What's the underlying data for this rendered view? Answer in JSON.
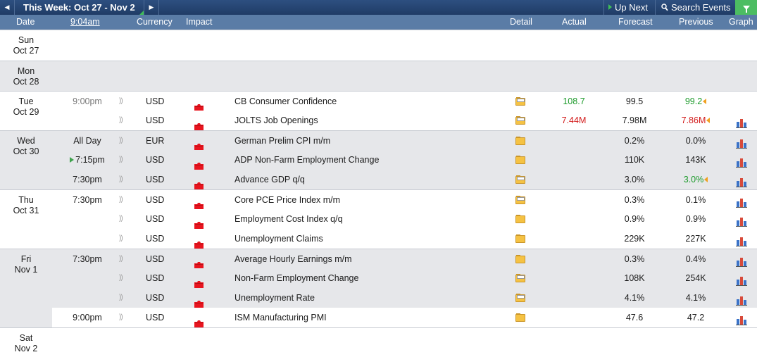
{
  "topbar": {
    "week_label": "This Week: Oct 27 - Nov 2",
    "prev_arrow": "◀",
    "next_arrow": "▶",
    "up_next": "Up Next",
    "search_events": "Search Events"
  },
  "header": {
    "date": "Date",
    "time": "9:04am",
    "currency": "Currency",
    "impact": "Impact",
    "detail": "Detail",
    "actual": "Actual",
    "forecast": "Forecast",
    "previous": "Previous",
    "graph": "Graph"
  },
  "colors": {
    "impact_high": "#e8141e",
    "actual_better": "#1c9a2a",
    "actual_worse": "#d21a1a",
    "header_bg": "#5a7ca6",
    "topbar_bg": "#203c66",
    "filter_bg": "#4cbd62"
  },
  "days": [
    {
      "day": "Sun",
      "date": "Oct 27"
    },
    {
      "day": "Mon",
      "date": "Oct 28"
    },
    {
      "day": "Tue",
      "date": "Oct 29"
    },
    {
      "day": "Wed",
      "date": "Oct 30"
    },
    {
      "day": "Thu",
      "date": "Oct 31"
    },
    {
      "day": "Fri",
      "date": "Nov 1"
    },
    {
      "day": "Sat",
      "date": "Nov 2"
    }
  ],
  "events": [
    {
      "time": "9:00pm",
      "currency": "USD",
      "impact": "high",
      "event": "CB Consumer Confidence",
      "actual": "108.7",
      "actual_status": "better",
      "forecast": "99.5",
      "previous": "99.2",
      "previous_status": "better",
      "revised": true,
      "graph": false
    },
    {
      "time": "",
      "currency": "USD",
      "impact": "high",
      "event": "JOLTS Job Openings",
      "actual": "7.44M",
      "actual_status": "worse",
      "forecast": "7.98M",
      "previous": "7.86M",
      "previous_status": "worse",
      "revised": true,
      "graph": true
    },
    {
      "time": "All Day",
      "currency": "EUR",
      "impact": "high",
      "event": "German Prelim CPI m/m",
      "actual": "",
      "forecast": "0.2%",
      "previous": "0.0%",
      "graph": true
    },
    {
      "time": "7:15pm",
      "up_next": true,
      "currency": "USD",
      "impact": "high",
      "event": "ADP Non-Farm Employment Change",
      "actual": "",
      "forecast": "110K",
      "previous": "143K",
      "graph": true
    },
    {
      "time": "7:30pm",
      "currency": "USD",
      "impact": "high",
      "event": "Advance GDP q/q",
      "actual": "",
      "forecast": "3.0%",
      "previous": "3.0%",
      "previous_status": "better",
      "revised": true,
      "graph": true
    },
    {
      "time": "7:30pm",
      "currency": "USD",
      "impact": "high",
      "event": "Core PCE Price Index m/m",
      "actual": "",
      "forecast": "0.3%",
      "previous": "0.1%",
      "graph": true
    },
    {
      "time": "",
      "currency": "USD",
      "impact": "high",
      "event": "Employment Cost Index q/q",
      "actual": "",
      "forecast": "0.9%",
      "previous": "0.9%",
      "graph": true
    },
    {
      "time": "",
      "currency": "USD",
      "impact": "high",
      "event": "Unemployment Claims",
      "actual": "",
      "forecast": "229K",
      "previous": "227K",
      "graph": true
    },
    {
      "time": "7:30pm",
      "currency": "USD",
      "impact": "high",
      "event": "Average Hourly Earnings m/m",
      "actual": "",
      "forecast": "0.3%",
      "previous": "0.4%",
      "graph": true
    },
    {
      "time": "",
      "currency": "USD",
      "impact": "high",
      "event": "Non-Farm Employment Change",
      "actual": "",
      "forecast": "108K",
      "previous": "254K",
      "graph": true
    },
    {
      "time": "",
      "currency": "USD",
      "impact": "high",
      "event": "Unemployment Rate",
      "actual": "",
      "forecast": "4.1%",
      "previous": "4.1%",
      "graph": true
    },
    {
      "time": "9:00pm",
      "currency": "USD",
      "impact": "high",
      "event": "ISM Manufacturing PMI",
      "actual": "",
      "forecast": "47.6",
      "previous": "47.2",
      "graph": true
    }
  ]
}
